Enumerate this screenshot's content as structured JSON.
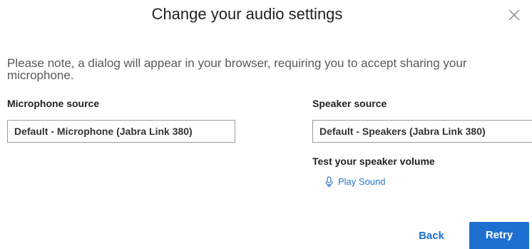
{
  "dialog": {
    "title": "Change your audio settings",
    "close_icon": "close-icon",
    "note": "Please note, a dialog will appear in your browser, requiring you to accept sharing your microphone."
  },
  "microphone": {
    "label": "Microphone source",
    "selected": "Default - Microphone (Jabra Link 380)"
  },
  "speaker": {
    "label": "Speaker source",
    "selected": "Default - Speakers (Jabra Link 380)",
    "test_label": "Test your speaker volume",
    "play_label": "Play Sound",
    "play_icon": "microphone-icon"
  },
  "actions": {
    "back_label": "Back",
    "retry_label": "Retry"
  },
  "colors": {
    "accent": "#1f6fd1",
    "link": "#2b76c9"
  }
}
